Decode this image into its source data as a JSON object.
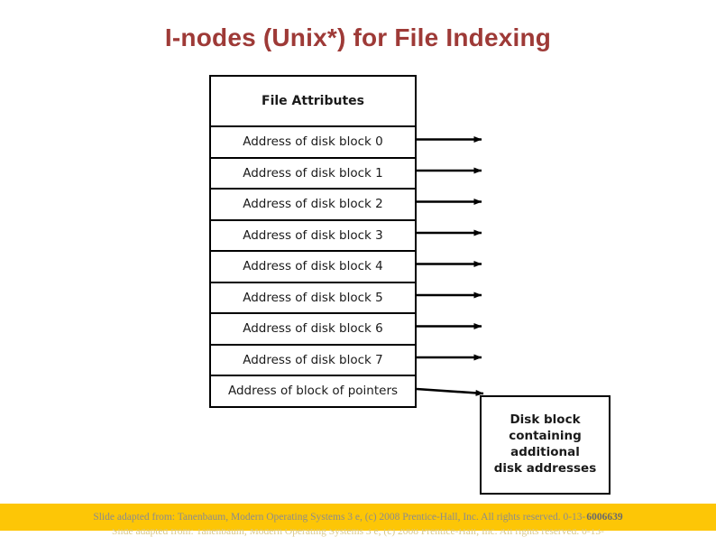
{
  "slide": {
    "title": "I-nodes (Unix*) for File Indexing",
    "title_color": "#9e3a37",
    "background_color": "#ffffff"
  },
  "diagram": {
    "inode_table": {
      "attributes_row": "File Attributes",
      "rows": [
        "Address of disk block 0",
        "Address of disk block 1",
        "Address of disk block 2",
        "Address of disk block 3",
        "Address of disk block 4",
        "Address of disk block 5",
        "Address of disk block 6",
        "Address of disk block 7",
        "Address of block of pointers"
      ]
    },
    "disk_block_box": {
      "line1": "Disk block",
      "line2": "containing",
      "line3": "additional",
      "line4": "disk addresses"
    },
    "arrow_count": 9,
    "line_color": "#000000"
  },
  "footer": {
    "bar_color": "#fdc606",
    "credit": "Slide adapted from: Tanenbaum, Modern Operating Systems 3 e, (c) 2008 Prentice-Hall, Inc. All rights reserved. 0-13-",
    "isbn": "6006639"
  }
}
